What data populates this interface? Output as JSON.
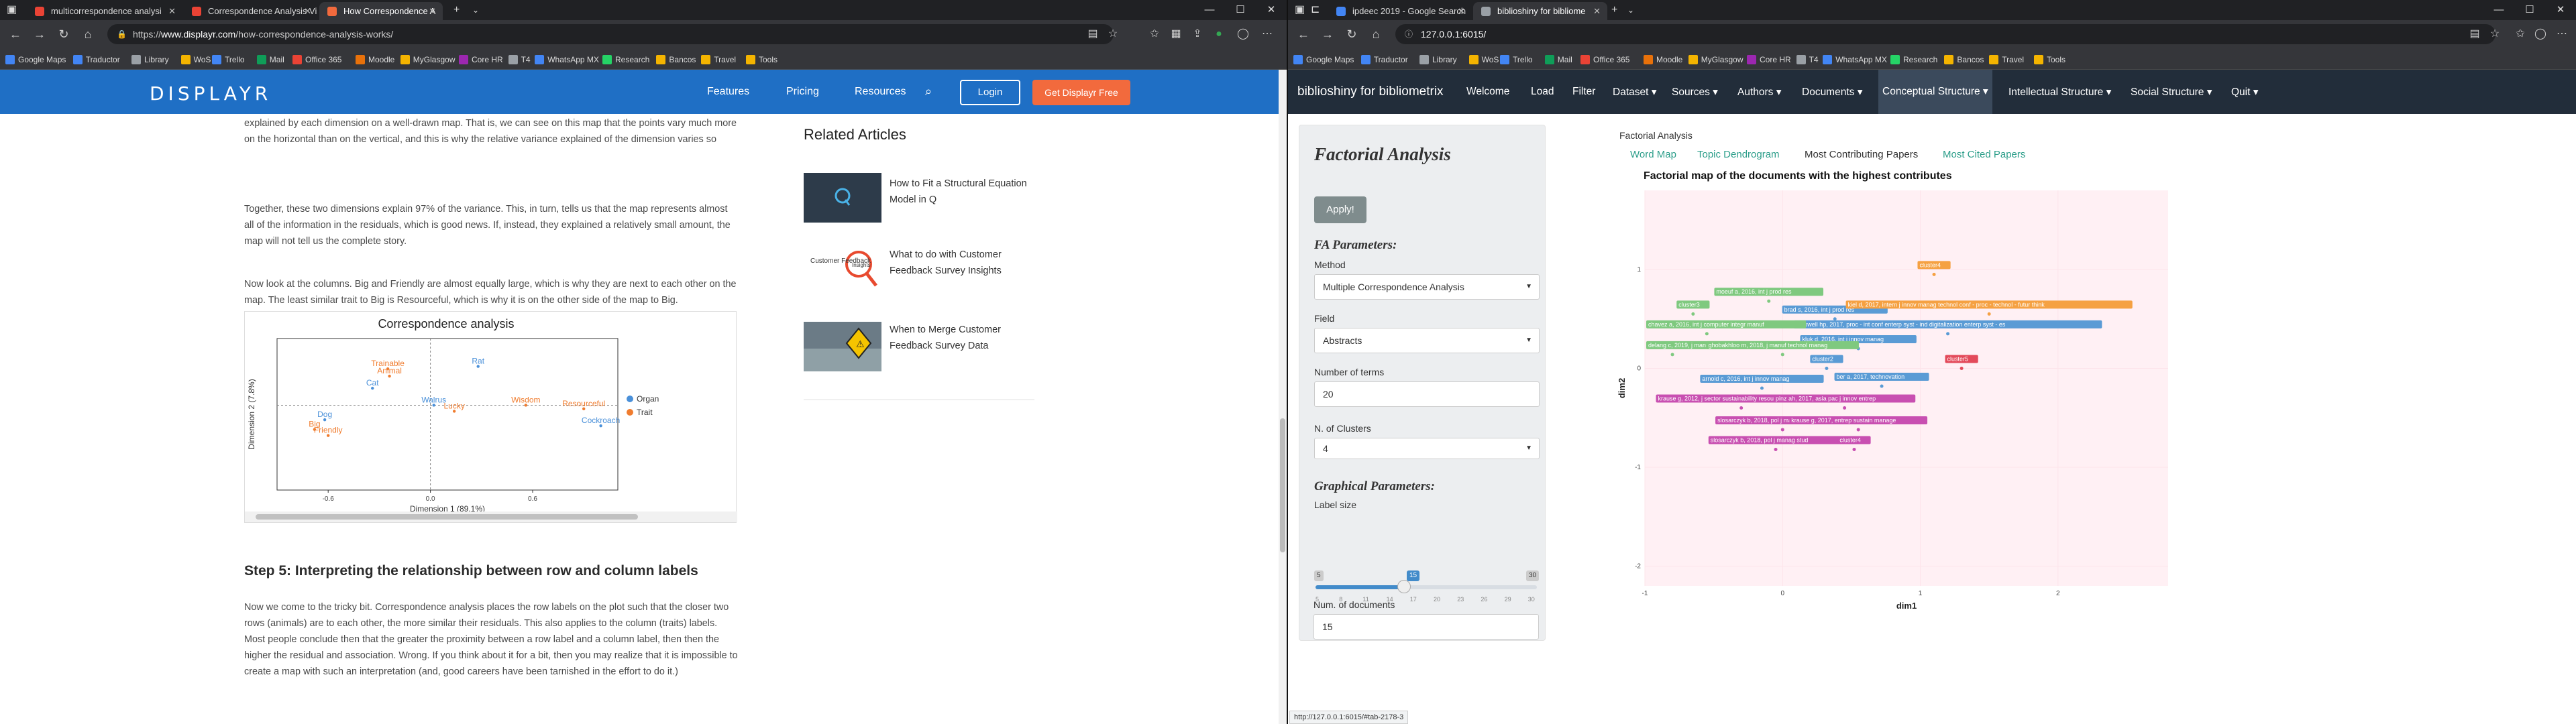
{
  "left_window": {
    "tabs": [
      {
        "title": "multicorrespondence analysi",
        "active": false,
        "color": "#ea4335"
      },
      {
        "title": "Correspondence Analysis Vi",
        "active": false,
        "color": "#ea4335"
      },
      {
        "title": "How Correspondence A",
        "active": true,
        "color": "#f26a3d"
      }
    ],
    "url_prefix": "https://",
    "url_host": "www.displayr.com",
    "url_path": "/how-correspondence-analysis-works/",
    "bookmarks": [
      "Google Maps",
      "Traductor",
      "Library",
      "WoS",
      "Trello",
      "Mail",
      "Office 365",
      "Moodle",
      "MyGlasgow",
      "Core HR",
      "T4",
      "WhatsApp MX",
      "Research",
      "Bancos",
      "Travel",
      "Tools"
    ],
    "site": {
      "logo": "DISPLAYR",
      "nav": [
        "Features",
        "Pricing",
        "Resources"
      ],
      "login": "Login",
      "cta": "Get Displayr Free"
    },
    "article": {
      "para1": "explained by each dimension on a well-drawn map. That is, we can see on this map that the points vary much more on the horizontal than on the vertical, and this is why the relative variance explained of the dimension varies so greatly.",
      "para2": "Together, these two dimensions explain 97% of the variance.  This, in turn, tells us that the map represents almost all of the information in the residuals, which is good news. If, instead, they explained a relatively small amount, the map will not tell us the complete story.",
      "para3": "Now look at the columns. Big and Friendly are almost equally large, which is why they are next to each other on the map. The least similar trait to Big is Resourceful, which is why it is on the other side of the map to Big.",
      "heading": "Step 5: Interpreting the relationship between row and column labels",
      "para4": "Now we come to the tricky bit. Correspondence analysis places the row labels on the plot such that the closer two rows (animals) are to each other, the more similar their residuals. This also applies to the column (traits) labels. Most people conclude then that the greater the proximity between a row label and a column label, then then the higher the residual and association. Wrong. If you think about it for a bit, then you may realize that it is impossible to create a map with such an interpretation (and, good careers have been tarnished in the effort to do it.)"
    },
    "related": {
      "title": "Related Articles",
      "items": [
        "How to Fit a Structural Equation Model in Q",
        "What to do with Customer Feedback Survey Insights",
        "When to Merge Customer Feedback Survey Data"
      ],
      "thumb_texts": [
        "Customer Feedback",
        "Insights"
      ]
    }
  },
  "right_window": {
    "tabs": [
      {
        "title": "ipdeec 2019 - Google Search",
        "active": false,
        "color": "#4285f4"
      },
      {
        "title": "biblioshiny for bibliome",
        "active": true,
        "color": "#5f6368"
      }
    ],
    "url": "127.0.0.1:6015/",
    "bookmarks": [
      "Google Maps",
      "Traductor",
      "Library",
      "WoS",
      "Trello",
      "Mail",
      "Office 365",
      "Moodle",
      "MyGlasgow",
      "Core HR",
      "T4",
      "WhatsApp MX",
      "Research",
      "Bancos",
      "Travel",
      "Tools"
    ],
    "app": {
      "brand": "biblioshiny for bibliometrix",
      "nav": [
        "Welcome",
        "Load",
        "Filter",
        "Dataset ▾",
        "Sources ▾",
        "Authors ▾",
        "Documents ▾",
        "Conceptual Structure ▾",
        "Intellectual Structure ▾",
        "Social Structure ▾",
        "Quit ▾"
      ],
      "sidebar": {
        "title": "Factorial Analysis",
        "apply": "Apply!",
        "fa_params": "FA Parameters:",
        "method_label": "Method",
        "method_value": "Multiple Correspondence Analysis",
        "field_label": "Field",
        "field_value": "Abstracts",
        "terms_label": "Number of terms",
        "terms_value": "20",
        "clusters_label": "N. of Clusters",
        "clusters_value": "4",
        "graph_params": "Graphical Parameters:",
        "label_size_label": "Label size",
        "label_size": {
          "min": "5",
          "max": "30",
          "value": "15",
          "ticks": [
            "5",
            "8",
            "11",
            "14",
            "17",
            "20",
            "23",
            "26",
            "29",
            "30"
          ]
        },
        "docs_label": "Num. of documents",
        "docs_value": "15"
      },
      "main_heading": "Factorial Analysis",
      "tabs": [
        "Word Map",
        "Topic Dendrogram",
        "Most Contributing Papers",
        "Most Cited Papers"
      ],
      "active_tab": "Most Contributing Papers",
      "plot_title": "Factorial map of the documents with the highest contributes"
    },
    "status_url": "http://127.0.0.1:6015/#tab-2178-3"
  },
  "chart_data": [
    {
      "type": "scatter",
      "title": "Correspondence analysis",
      "xlabel": "Dimension 1 (89.1%)",
      "ylabel": "Dimension 2 (7.8%)",
      "xlim": [
        -0.9,
        1.1
      ],
      "ylim": [
        -0.7,
        0.55
      ],
      "xticks": [
        "-0.6",
        "0.0",
        "0.6"
      ],
      "legend": [
        "Organ",
        "Trait"
      ],
      "colors": {
        "row": "#4a90d9",
        "col": "#f07c2e"
      },
      "series": [
        {
          "name": "Organ",
          "points": [
            {
              "label": "Rat",
              "x": 0.28,
              "y": 0.32
            },
            {
              "label": "Cat",
              "x": -0.34,
              "y": 0.14
            },
            {
              "label": "Dog",
              "x": -0.62,
              "y": -0.12
            },
            {
              "label": "Walrus",
              "x": 0.02,
              "y": 0.0
            },
            {
              "label": "Cockroach",
              "x": 1.0,
              "y": -0.17
            }
          ]
        },
        {
          "name": "Trait",
          "points": [
            {
              "label": "Trainable",
              "x": -0.25,
              "y": 0.3
            },
            {
              "label": "Animal",
              "x": -0.24,
              "y": 0.24
            },
            {
              "label": "Lucky",
              "x": 0.14,
              "y": -0.05
            },
            {
              "label": "Wisdom",
              "x": 0.56,
              "y": 0.0
            },
            {
              "label": "Resourceful",
              "x": 0.9,
              "y": -0.03
            },
            {
              "label": "Big",
              "x": -0.68,
              "y": -0.2
            },
            {
              "label": "Friendly",
              "x": -0.6,
              "y": -0.25
            }
          ]
        }
      ]
    },
    {
      "type": "scatter",
      "title": "Factorial map of the documents with the highest contributes",
      "xlabel": "dim1",
      "ylabel": "dim2",
      "xlim": [
        -1,
        2.8
      ],
      "ylim": [
        -2.2,
        1.8
      ],
      "xticks": [
        "-1",
        "0",
        "1",
        "2"
      ],
      "yticks": [
        "1",
        "0",
        "-1",
        "-2"
      ],
      "clusters": [
        {
          "name": "cluster1",
          "color": "#c84fb1",
          "points": [
            {
              "label": "krause g, 2012, j sector sustainability resour",
              "x": -0.3,
              "y": -0.4
            },
            {
              "label": "slosarczyk b, 2018, pol j manag stud",
              "x": 0.0,
              "y": -0.62
            },
            {
              "label": "slosarczyk b, 2018, pol j manag stud",
              "x": -0.05,
              "y": -0.82
            },
            {
              "label": "pinz ah, 2017, asia pac j innov entrep",
              "x": 0.45,
              "y": -0.4
            },
            {
              "label": "krause g, 2017, entrep sustain manage",
              "x": 0.55,
              "y": -0.62
            },
            {
              "label": "cluster4",
              "x": 0.52,
              "y": -0.82
            }
          ]
        },
        {
          "name": "cluster2",
          "color": "#5a9bd5",
          "points": [
            {
              "label": "kluk d, 2016, int j innov manag",
              "x": 0.55,
              "y": 0.2
            },
            {
              "label": "braswell hp, 2017, proc - int conf enterp syst - ind digitalization enterp syst - es",
              "x": 1.2,
              "y": 0.35
            },
            {
              "label": "cluster2",
              "x": 0.32,
              "y": 0.0
            },
            {
              "label": "arnold c, 2016, int j innov manag",
              "x": -0.15,
              "y": -0.2
            },
            {
              "label": "ber a, 2017, technovation",
              "x": 0.72,
              "y": -0.18
            },
            {
              "label": "brad s, 2016, int j prod res",
              "x": 0.38,
              "y": 0.5
            }
          ]
        },
        {
          "name": "cluster3",
          "color": "#7fc97f",
          "points": [
            {
              "label": "moeuf a, 2016, int j prod res",
              "x": -0.1,
              "y": 0.68
            },
            {
              "label": "cluster3",
              "x": -0.65,
              "y": 0.55
            },
            {
              "label": "chavez a, 2016, int j computer integr manuf",
              "x": -0.55,
              "y": 0.35
            },
            {
              "label": "delang c, 2019, j manuf technol manag",
              "x": -0.8,
              "y": 0.14
            },
            {
              "label": "ghobakhloo m, 2018, j manuf technol manag",
              "x": 0.0,
              "y": 0.14
            }
          ]
        },
        {
          "name": "cluster4",
          "color": "#f5a142",
          "points": [
            {
              "label": "cluster4",
              "x": 1.1,
              "y": 0.95
            },
            {
              "label": "kiel d, 2017, intern j innov manag technol conf - proc - technol - futur think",
              "x": 1.5,
              "y": 0.55
            }
          ]
        },
        {
          "name": "cluster5",
          "color": "#e34a5a",
          "points": [
            {
              "label": "cluster5",
              "x": 1.3,
              "y": 0.0
            }
          ]
        }
      ]
    }
  ]
}
